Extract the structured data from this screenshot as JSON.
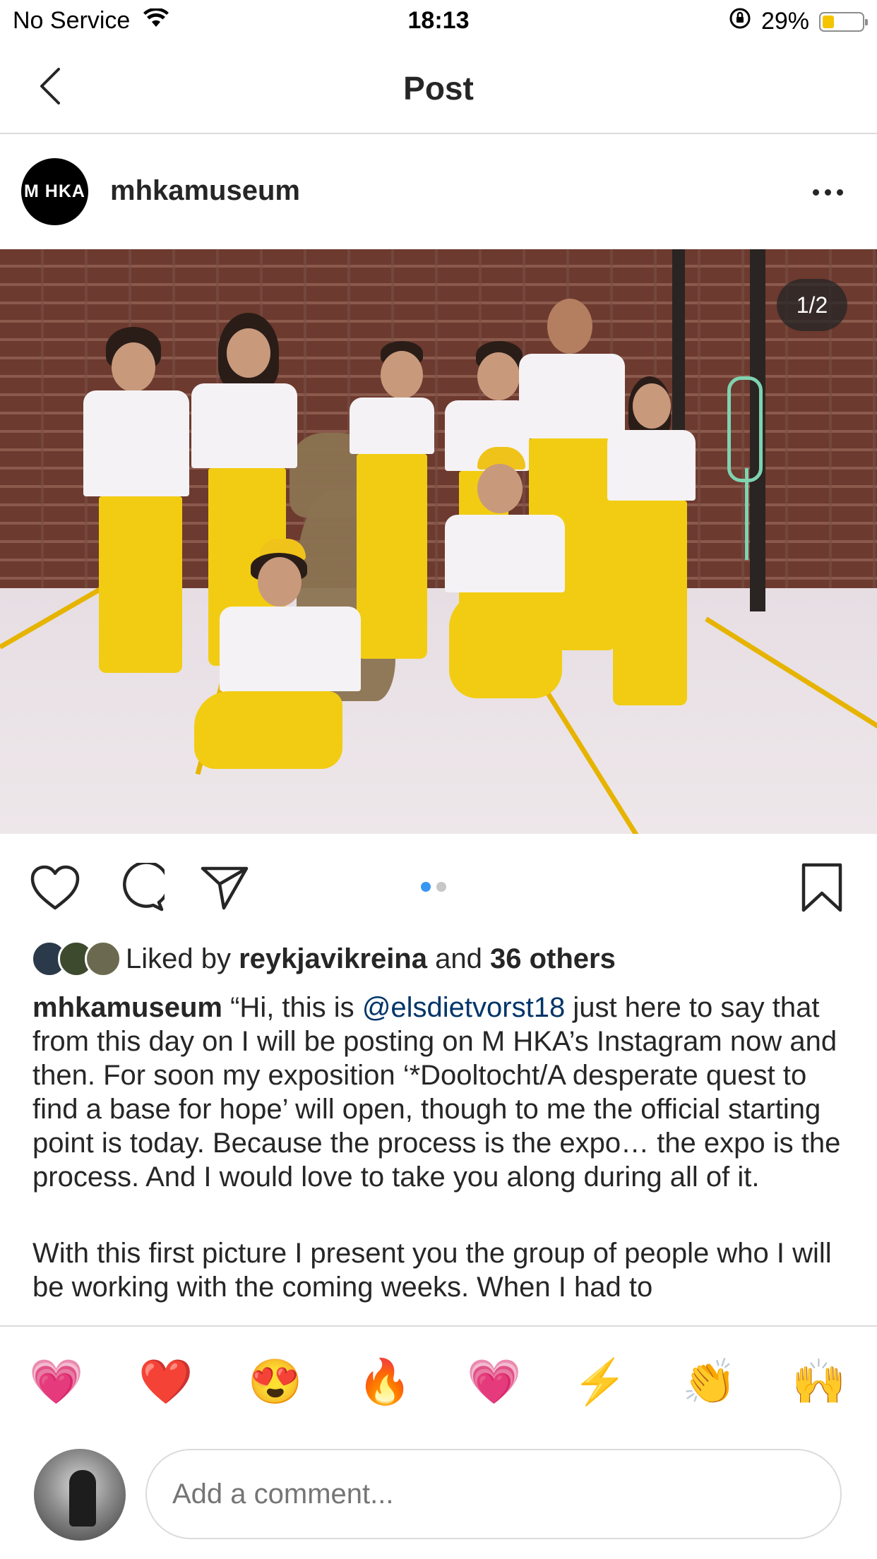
{
  "status_bar": {
    "carrier": "No Service",
    "time": "18:13",
    "battery_percent": "29%",
    "battery_level": 0.29,
    "battery_color": "#f5c400",
    "icons": [
      "wifi-icon",
      "rotation-lock-icon",
      "battery-icon"
    ]
  },
  "nav": {
    "title": "Post",
    "back_icon": "chevron-left-icon"
  },
  "post": {
    "username": "mhkamuseum",
    "avatar_text": "M HKA",
    "more_icon": "ellipsis-icon",
    "image_counter": "1/2",
    "carousel": {
      "count": 2,
      "active_index": 0,
      "active_color": "#3897f0"
    }
  },
  "actions": {
    "icons": [
      "heart-icon",
      "comment-icon",
      "share-icon",
      "bookmark-icon"
    ]
  },
  "likes": {
    "prefix": "Liked by",
    "liker": "reykjavikreina",
    "connector": "and",
    "others": "36 others"
  },
  "caption": {
    "username": "mhkamuseum",
    "text_before_mention": "“Hi, this is",
    "mention": "@elsdietvorst18",
    "text_after_mention": "just here to say that from this day on I will be posting on M HKA’s Instagram now and then. For soon my exposition ‘*Dooltocht/A desperate quest to find a base for hope’ will open, though to me the official starting point is today. Because the process is the expo… the expo is the process. And I would love to take you along during all of it.",
    "paragraph2": "With this first picture I present you the group of people who I will be working with the coming weeks. When I had to",
    "mention_color": "#003569"
  },
  "reactions": [
    "💗",
    "❤️",
    "😍",
    "🔥",
    "💗",
    "⚡",
    "👏",
    "🙌"
  ],
  "comment": {
    "placeholder": "Add a comment..."
  }
}
